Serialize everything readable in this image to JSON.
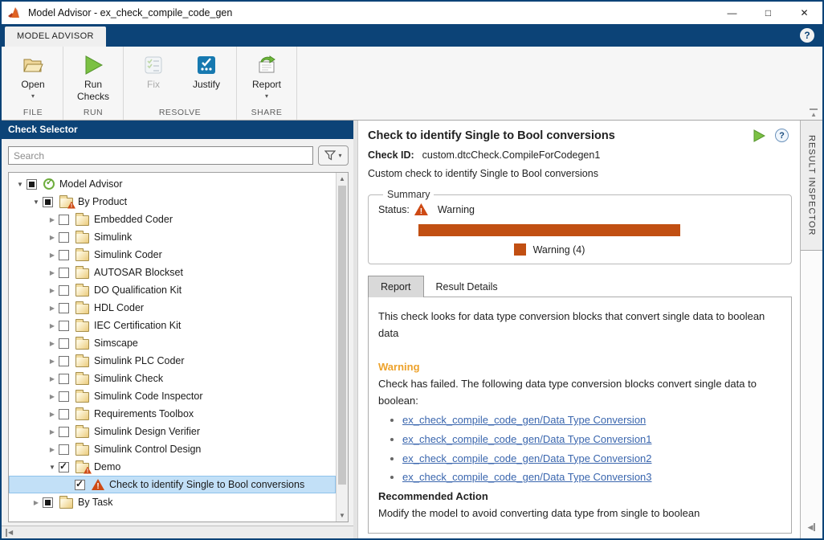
{
  "window": {
    "title": "Model Advisor - ex_check_compile_code_gen",
    "minimize": "—",
    "maximize": "□",
    "close": "✕"
  },
  "ribbon": {
    "tab_label": "MODEL ADVISOR",
    "help": "?",
    "groups": [
      {
        "label": "FILE",
        "buttons": [
          {
            "label": "Open",
            "dropdown": true
          }
        ]
      },
      {
        "label": "RUN",
        "buttons": [
          {
            "label": "Run Checks"
          }
        ]
      },
      {
        "label": "RESOLVE",
        "buttons": [
          {
            "label": "Fix",
            "disabled": true
          },
          {
            "label": "Justify"
          }
        ]
      },
      {
        "label": "SHARE",
        "buttons": [
          {
            "label": "Report",
            "dropdown": true
          }
        ]
      }
    ]
  },
  "check_selector": {
    "title": "Check Selector",
    "search_placeholder": "Search",
    "tree": [
      {
        "label": "Model Advisor",
        "level": 0,
        "expand": "open",
        "check": "partial",
        "icon": "ok"
      },
      {
        "label": "By Product",
        "level": 1,
        "expand": "open",
        "check": "partial",
        "icon": "folder-warn"
      },
      {
        "label": "Embedded Coder",
        "level": 2,
        "expand": "closed",
        "check": "none",
        "icon": "folder"
      },
      {
        "label": "Simulink",
        "level": 2,
        "expand": "closed",
        "check": "none",
        "icon": "folder"
      },
      {
        "label": "Simulink Coder",
        "level": 2,
        "expand": "closed",
        "check": "none",
        "icon": "folder"
      },
      {
        "label": "AUTOSAR Blockset",
        "level": 2,
        "expand": "closed",
        "check": "none",
        "icon": "folder"
      },
      {
        "label": "DO Qualification Kit",
        "level": 2,
        "expand": "closed",
        "check": "none",
        "icon": "folder"
      },
      {
        "label": "HDL Coder",
        "level": 2,
        "expand": "closed",
        "check": "none",
        "icon": "folder"
      },
      {
        "label": "IEC Certification Kit",
        "level": 2,
        "expand": "closed",
        "check": "none",
        "icon": "folder"
      },
      {
        "label": "Simscape",
        "level": 2,
        "expand": "closed",
        "check": "none",
        "icon": "folder"
      },
      {
        "label": "Simulink PLC Coder",
        "level": 2,
        "expand": "closed",
        "check": "none",
        "icon": "folder"
      },
      {
        "label": "Simulink Check",
        "level": 2,
        "expand": "closed",
        "check": "none",
        "icon": "folder"
      },
      {
        "label": "Simulink Code Inspector",
        "level": 2,
        "expand": "closed",
        "check": "none",
        "icon": "folder"
      },
      {
        "label": "Requirements Toolbox",
        "level": 2,
        "expand": "closed",
        "check": "none",
        "icon": "folder"
      },
      {
        "label": "Simulink Design Verifier",
        "level": 2,
        "expand": "closed",
        "check": "none",
        "icon": "folder"
      },
      {
        "label": "Simulink Control Design",
        "level": 2,
        "expand": "closed",
        "check": "none",
        "icon": "folder"
      },
      {
        "label": "Demo",
        "level": 2,
        "expand": "open",
        "check": "checked",
        "icon": "folder-warn"
      },
      {
        "label": "Check to identify Single to Bool conversions",
        "level": 3,
        "expand": "none",
        "check": "checked",
        "icon": "warning",
        "selected": true
      },
      {
        "label": "By Task",
        "level": 1,
        "expand": "closed",
        "check": "partial",
        "icon": "folder"
      }
    ]
  },
  "detail": {
    "title": "Check to identify Single to Bool conversions",
    "check_id_label": "Check ID:",
    "check_id": "custom.dtcCheck.CompileForCodegen1",
    "description": "Custom check to identify Single to Bool conversions",
    "summary": {
      "legend": "Summary",
      "status_label": "Status:",
      "status": "Warning",
      "chart_data": {
        "type": "bar",
        "categories": [
          "Warning"
        ],
        "values": [
          4
        ],
        "bar_color": "#C14F12",
        "legend_label": "Warning (4)",
        "legend_position": "bottom-center"
      }
    },
    "tabs": [
      {
        "label": "Report",
        "active": true
      },
      {
        "label": "Result Details",
        "active": false
      }
    ],
    "report": {
      "intro": "This check looks for data type conversion blocks that convert single data to boolean data",
      "warning_heading": "Warning",
      "warning_text": "Check has failed. The following data type conversion blocks convert single data to boolean:",
      "links": [
        "ex_check_compile_code_gen/Data Type Conversion",
        "ex_check_compile_code_gen/Data Type Conversion1",
        "ex_check_compile_code_gen/Data Type Conversion2",
        "ex_check_compile_code_gen/Data Type Conversion3"
      ],
      "recommended_heading": "Recommended Action",
      "recommended_text": "Modify the model to avoid converting data type from single to boolean"
    }
  },
  "result_inspector": {
    "label": "RESULT INSPECTOR"
  },
  "icons": {
    "dropdown": "▾",
    "expand_open": "▼",
    "expand_closed": "▶",
    "scroll_up": "▲",
    "scroll_down": "▼",
    "collapse_up": "▲",
    "collapse_left": "◀",
    "help": "?"
  },
  "colors": {
    "navy": "#0C4377",
    "warning_bar": "#C14F12",
    "warning_heading": "#EDA22B",
    "link": "#3A66AE",
    "selection": "#C2E0F7"
  }
}
